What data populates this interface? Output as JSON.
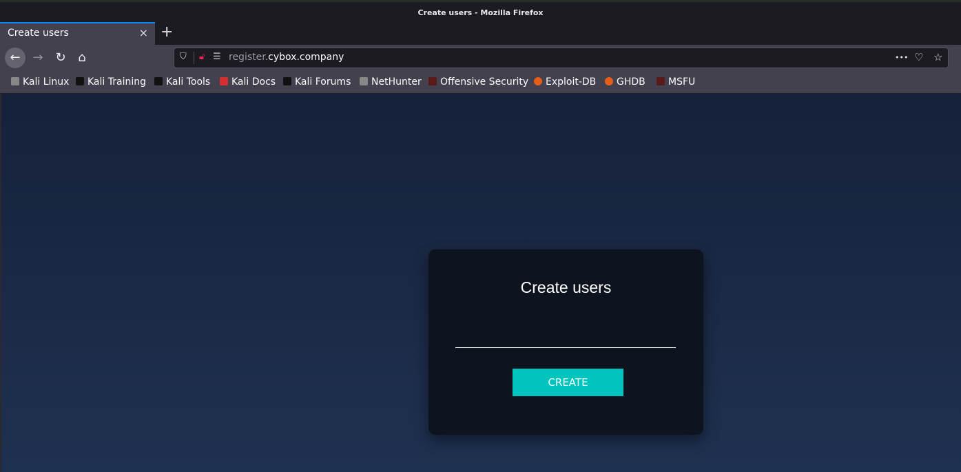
{
  "window": {
    "title": "Create users - Mozilla Firefox"
  },
  "tab": {
    "label": "Create users",
    "close": "×",
    "new_tab": "+"
  },
  "nav": {
    "back": "←",
    "forward": "→",
    "reload": "↻",
    "home": "⌂",
    "url_subdomain": "register.",
    "url_domain": "cybox.company",
    "menu": "•••"
  },
  "bookmarks": [
    {
      "label": "Kali Linux",
      "icon": "kali-dragon-icon",
      "color": "#888"
    },
    {
      "label": "Kali Training",
      "icon": "kali-dragon-icon",
      "color": "#111"
    },
    {
      "label": "Kali Tools",
      "icon": "kali-dragon-icon",
      "color": "#111"
    },
    {
      "label": "Kali Docs",
      "icon": "docs-icon",
      "color": "#d32f2f"
    },
    {
      "label": "Kali Forums",
      "icon": "kali-dragon-icon",
      "color": "#111"
    },
    {
      "label": "NetHunter",
      "icon": "kali-dragon-icon",
      "color": "#888"
    },
    {
      "label": "Offensive Security",
      "icon": "offsec-icon",
      "color": "#5a1a1a"
    },
    {
      "label": "Exploit-DB",
      "icon": "exploitdb-icon",
      "color": "#e85d1a"
    },
    {
      "label": "GHDB",
      "icon": "exploitdb-icon",
      "color": "#e85d1a"
    },
    {
      "label": "MSFU",
      "icon": "offsec-icon",
      "color": "#5a1a1a"
    }
  ],
  "card": {
    "title": "Create users",
    "input_value": "",
    "button_label": "CREATE",
    "accent": "#00c4bd"
  }
}
